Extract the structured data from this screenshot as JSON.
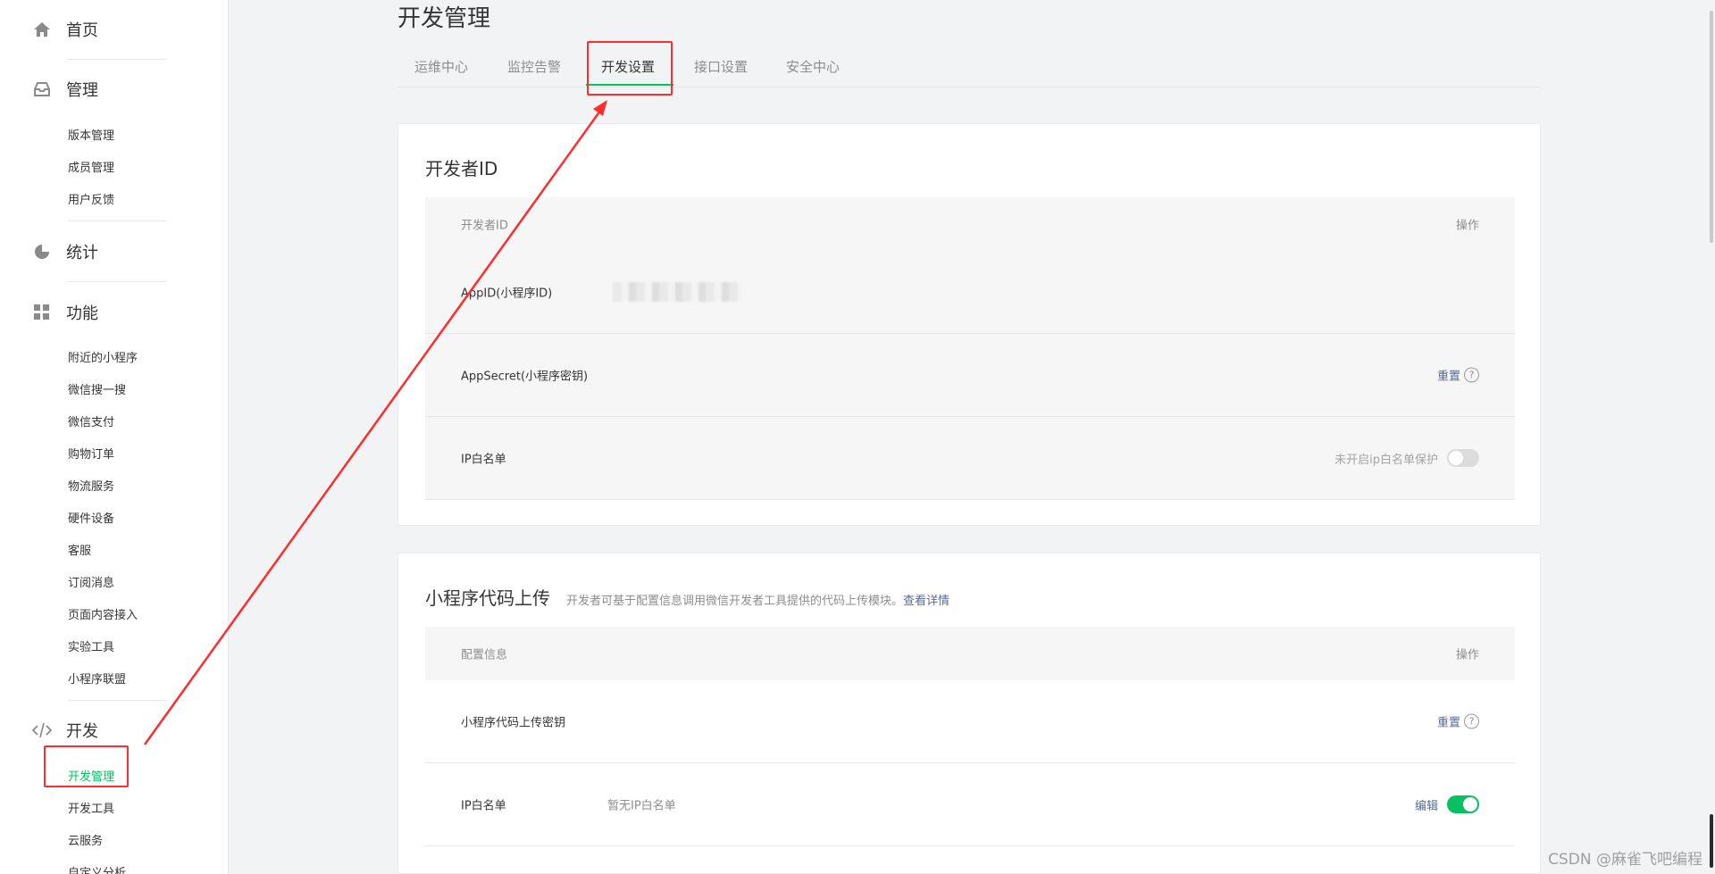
{
  "sidebar": {
    "home": {
      "label": "首页",
      "icon": "home-icon"
    },
    "manage": {
      "label": "管理",
      "icon": "inbox-icon",
      "items": [
        "版本管理",
        "成员管理",
        "用户反馈"
      ]
    },
    "stats": {
      "label": "统计",
      "icon": "pie-chart-icon"
    },
    "features": {
      "label": "功能",
      "icon": "grid-icon",
      "items": [
        "附近的小程序",
        "微信搜一搜",
        "微信支付",
        "购物订单",
        "物流服务",
        "硬件设备",
        "客服",
        "订阅消息",
        "页面内容接入",
        "实验工具",
        "小程序联盟"
      ]
    },
    "dev": {
      "label": "开发",
      "icon": "code-icon",
      "items": [
        "开发管理",
        "开发工具",
        "云服务",
        "自定义分析"
      ],
      "active_index": 0
    }
  },
  "main": {
    "title": "开发管理",
    "tabs": [
      "运维中心",
      "监控告警",
      "开发设置",
      "接口设置",
      "安全中心"
    ],
    "active_tab": 2,
    "developer_card": {
      "title": "开发者ID",
      "header_left": "开发者ID",
      "header_right": "操作",
      "rows": {
        "appid_label": "AppID(小程序ID)",
        "appsecret_label": "AppSecret(小程序密钥)",
        "appsecret_action": "重置",
        "ip_label": "IP白名单",
        "ip_status": "未开启ip白名单保护",
        "ip_switch_on": false
      }
    },
    "upload_card": {
      "title": "小程序代码上传",
      "desc": "开发者可基于配置信息调用微信开发者工具提供的代码上传模块。",
      "desc_link": "查看详情",
      "header_left": "配置信息",
      "header_right": "操作",
      "rows": {
        "key_label": "小程序代码上传密钥",
        "key_action": "重置",
        "ip_label": "IP白名单",
        "ip_value": "暂无IP白名单",
        "ip_action": "编辑",
        "ip_switch_on": true
      }
    }
  },
  "watermark": "CSDN @麻雀飞吧编程",
  "colors": {
    "accent": "#07c160",
    "link": "#576b95",
    "annotation": "#ff2d2d"
  }
}
